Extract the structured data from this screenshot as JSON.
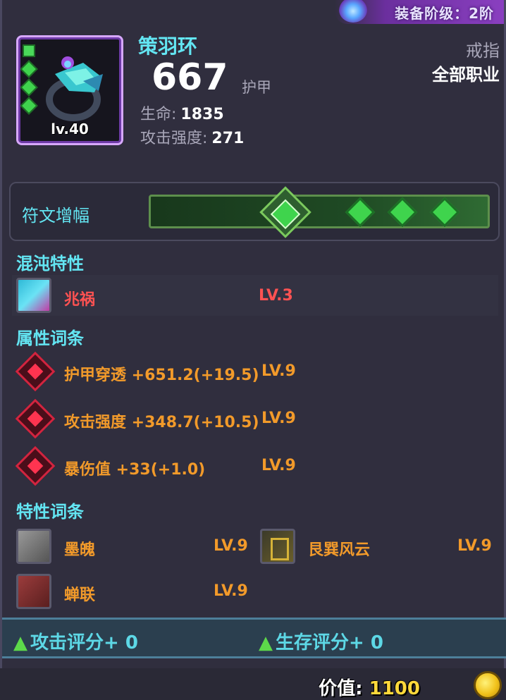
{
  "header": {
    "grade_badge": "装备阶级：2阶",
    "item_name": "策羽环",
    "item_level": "lv.40",
    "armor_value": "667",
    "armor_label": "护甲",
    "slot_type": "戒指",
    "class_requirement": "全部职业",
    "stats": [
      {
        "label": "生命:",
        "value": "1835"
      },
      {
        "label": "攻击强度:",
        "value": "271"
      }
    ]
  },
  "rune": {
    "label": "符文增幅"
  },
  "chaos_traits": {
    "title": "混沌特性",
    "items": [
      {
        "name": "兆祸",
        "level": "LV.3"
      }
    ]
  },
  "attribute_affixes": {
    "title": "属性词条",
    "items": [
      {
        "text": "护甲穿透 +651.2(+19.5)",
        "level": "LV.9"
      },
      {
        "text": "攻击强度 +348.7(+10.5)",
        "level": "LV.9"
      },
      {
        "text": "暴伤值 +33(+1.0)",
        "level": "LV.9"
      }
    ]
  },
  "trait_affixes": {
    "title": "特性词条",
    "items": [
      {
        "name": "墨魄",
        "level": "LV.9"
      },
      {
        "name": "艮巽风云",
        "level": "LV.9"
      },
      {
        "name": "蝉联",
        "level": "LV.9"
      }
    ]
  },
  "scores": {
    "attack": "攻击评分+ 0",
    "survival": "生存评分+ 0"
  },
  "footer": {
    "value_label": "价值:",
    "value": "1100"
  },
  "colors": {
    "cyan_heading": "#63e6f3",
    "orange_text": "#f29a2a",
    "red_text": "#ff5252",
    "score_green": "#5dd94a"
  },
  "icons": {
    "coin": "gold-coin-icon",
    "rune_gem": "green-gem-icon"
  }
}
